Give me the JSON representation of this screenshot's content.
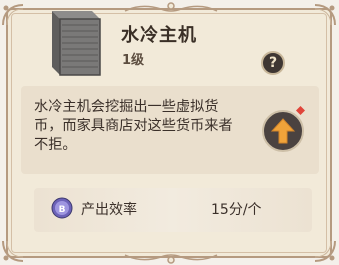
{
  "item": {
    "name": "水冷主机",
    "level": "1级",
    "description": "水冷主机会挖掘出一些虚拟货币，而家具商店对这些货币来者不拒。"
  },
  "help_button": {
    "icon": "question-icon",
    "label": "?"
  },
  "upgrade_button": {
    "icon": "upgrade-arrow-icon",
    "has_notification": true
  },
  "stat": {
    "icon": "coin-icon",
    "label": "产出效率",
    "value": "15分/个"
  },
  "colors": {
    "panel_bg": "#f2ead9",
    "border": "#b59a80",
    "arrow": "#f0a33a",
    "notification": "#e0453a"
  }
}
